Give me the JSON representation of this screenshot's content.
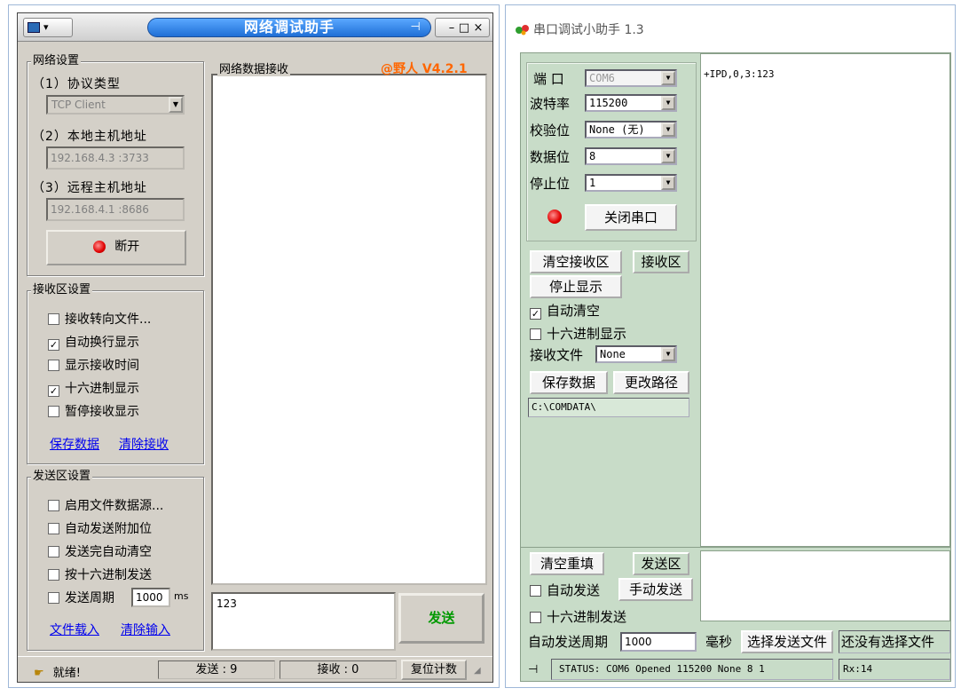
{
  "left_window": {
    "title": "网络调试助手",
    "title_controls": "- □ ×",
    "version": "@野人 V4.2.1",
    "net_settings": {
      "group_label": "网络设置",
      "protocol_label": "（1）协议类型",
      "protocol_value": "TCP Client",
      "local_label": "（2）本地主机地址",
      "local_value": "192.168.4.3 :3733",
      "remote_label": "（3）远程主机地址",
      "remote_value": "192.168.4.1 :8686",
      "connect_button": "断开"
    },
    "recv_settings": {
      "group_label": "接收区设置",
      "options": [
        {
          "label": "接收转向文件...",
          "checked": false
        },
        {
          "label": "自动换行显示",
          "checked": true
        },
        {
          "label": "显示接收时间",
          "checked": false
        },
        {
          "label": "十六进制显示",
          "checked": true
        },
        {
          "label": "暂停接收显示",
          "checked": false
        }
      ],
      "save_link": "保存数据",
      "clear_link": "清除接收"
    },
    "send_settings": {
      "group_label": "发送区设置",
      "options": [
        {
          "label": "启用文件数据源...",
          "checked": false
        },
        {
          "label": "自动发送附加位",
          "checked": false
        },
        {
          "label": "发送完自动清空",
          "checked": false
        },
        {
          "label": "按十六进制发送",
          "checked": false
        }
      ],
      "period_label": "发送周期",
      "period_value": "1000",
      "period_unit": "ms",
      "load_link": "文件载入",
      "clear_link": "清除输入"
    },
    "recv_caption": "网络数据接收",
    "send_text": "123",
    "send_button": "发送",
    "status": {
      "ready": "就绪!",
      "sent": "发送 : 9",
      "received": "接收 : 0",
      "reset_button": "复位计数"
    }
  },
  "right_window": {
    "title": "串口调试小助手 1.3",
    "port_label": "端  口",
    "port_value": "COM6",
    "baud_label": "波特率",
    "baud_value": "115200",
    "parity_label": "校验位",
    "parity_value": "None (无)",
    "databits_label": "数据位",
    "databits_value": "8",
    "stopbits_label": "停止位",
    "stopbits_value": "1",
    "close_port_button": "关闭串口",
    "clear_recv_button": "清空接收区",
    "recv_area_label": "接收区",
    "stop_display_button": "停止显示",
    "auto_clear_label": "自动清空",
    "auto_clear_checked": true,
    "hex_display_label": "十六进制显示",
    "hex_display_checked": false,
    "recv_file_label": "接收文件",
    "recv_file_value": "None",
    "save_data_button": "保存数据",
    "change_path_button": "更改路径",
    "path_value": "C:\\COMDATA\\",
    "recv_text": "+IPD,0,3:123",
    "clear_refill_button": "清空重填",
    "send_area_label": "发送区",
    "auto_send_label": "自动发送",
    "manual_send_button": "手动发送",
    "hex_send_label": "十六进制发送",
    "auto_period_label": "自动发送周期",
    "auto_period_value": "1000",
    "ms_label": "毫秒",
    "choose_file_button": "选择发送文件",
    "no_file_label": "还没有选择文件",
    "status_text": "STATUS: COM6 Opened 115200 None  8 1",
    "rx_text": "Rx:14"
  },
  "colors": {
    "title_blue": "#1f6fd6",
    "version_orange": "#ff6600",
    "send_green": "#009900",
    "link_blue": "#0000ee",
    "serial_bg": "#c8dcc8"
  }
}
